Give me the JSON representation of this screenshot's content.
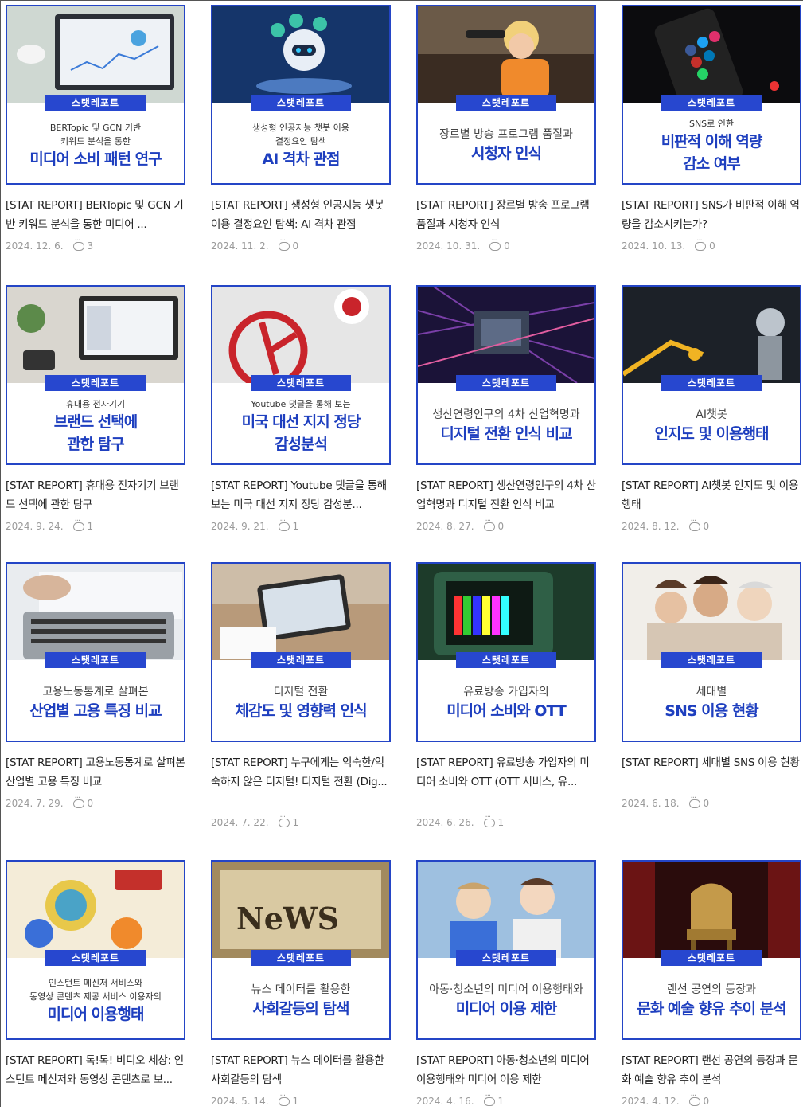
{
  "tag_label": "스탯레포트",
  "colors": {
    "accent": "#2747cf",
    "headline": "#1e3fbf",
    "border": "#2445c6"
  },
  "cards": [
    {
      "sub": "BERTopic 및 GCN 기반\n키워드 분석을 통한",
      "main": "미디어 소비 패턴 연구",
      "title": "[STAT REPORT] BERTopic 및 GCN 기반 키워드 분석을 통한 미디어 ...",
      "date": "2024. 12. 6.",
      "comments": "3"
    },
    {
      "sub": "생성형 인공지능 챗봇 이용\n결정요인 탐색",
      "main": "AI 격차 관점",
      "title": "[STAT REPORT] 생성형 인공지능 챗봇 이용 결정요인 탐색: AI 격차 관점",
      "date": "2024. 11. 2.",
      "comments": "0"
    },
    {
      "sub": "장르별 방송 프로그램 품질과",
      "main": "시청자 인식",
      "title": "[STAT REPORT] 장르별 방송 프로그램 품질과 시청자 인식",
      "date": "2024. 10. 31.",
      "comments": "0"
    },
    {
      "sub": "SNS로 인한",
      "main": "비판적 이해 역량\n감소 여부",
      "title": "[STAT REPORT] SNS가 비판적 이해 역량을 감소시키는가?",
      "date": "2024. 10. 13.",
      "comments": "0"
    },
    {
      "sub": "휴대용 전자기기",
      "main": "브랜드 선택에\n관한 탐구",
      "title": "[STAT REPORT] 휴대용 전자기기 브랜드 선택에 관한 탐구",
      "date": "2024. 9. 24.",
      "comments": "1"
    },
    {
      "sub": "Youtube 댓글을 통해 보는",
      "main": "미국 대선 지지 정당\n감성분석",
      "title": "[STAT REPORT] Youtube 댓글을 통해 보는 미국 대선 지지 정당 감성분...",
      "date": "2024. 9. 21.",
      "comments": "1"
    },
    {
      "sub": "생산연령인구의 4차 산업혁명과",
      "main": "디지털 전환 인식 비교",
      "title": "[STAT REPORT] 생산연령인구의 4차 산업혁명과 디지털 전환 인식 비교",
      "date": "2024. 8. 27.",
      "comments": "0"
    },
    {
      "sub": "AI챗봇",
      "main": "인지도 및 이용행태",
      "title": "[STAT REPORT] AI챗봇 인지도 및 이용행태",
      "date": "2024. 8. 12.",
      "comments": "0"
    },
    {
      "sub": "고용노동통계로 살펴본",
      "main": "산업별 고용 특징 비교",
      "title": "[STAT REPORT] 고용노동통계로 살펴본 산업별 고용 특징 비교",
      "date": "2024. 7. 29.",
      "comments": "0"
    },
    {
      "sub": "디지털 전환",
      "main": "체감도 및 영향력 인식",
      "title": "[STAT REPORT] 누구에게는 익숙한/익숙하지 않은 디지털! 디지털 전환 (Dig...",
      "date": "2024. 7. 22.",
      "comments": "1"
    },
    {
      "sub": "유료방송 가입자의",
      "main": "미디어 소비와 OTT",
      "title": "[STAT REPORT] 유료방송 가입자의 미디어 소비와 OTT (OTT 서비스, 유...",
      "date": "2024. 6. 26.",
      "comments": "1"
    },
    {
      "sub": "세대별",
      "main": "SNS 이용 현황",
      "title": "[STAT REPORT] 세대별 SNS 이용 현황",
      "date": "2024. 6. 18.",
      "comments": "0"
    },
    {
      "sub": "인스턴트 메신저 서비스와\n동영상 콘텐츠 제공 서비스 이용자의",
      "main": "미디어 이용행태",
      "title": "[STAT REPORT] 톡!톡! 비디오 세상: 인스턴트 메신저와 동영상 콘텐츠로 보...",
      "date": "",
      "comments": ""
    },
    {
      "sub": "뉴스 데이터를 활용한",
      "main": "사회갈등의 탐색",
      "title": "[STAT REPORT] 뉴스 데이터를 활용한 사회갈등의 탐색",
      "date": "2024. 5. 14.",
      "comments": "1"
    },
    {
      "sub": "아동·청소년의 미디어 이용행태와",
      "main": "미디어 이용 제한",
      "title": "[STAT REPORT] 아동·청소년의 미디어 이용행태와 미디어 이용 제한",
      "date": "2024. 4. 16.",
      "comments": "1"
    },
    {
      "sub": "랜선 공연의 등장과",
      "main": "문화 예술 향유 추이 분석",
      "title": "[STAT REPORT] 랜선 공연의 등장과 문화 예술 향유 추이 분석",
      "date": "2024. 4. 12.",
      "comments": "0"
    }
  ]
}
